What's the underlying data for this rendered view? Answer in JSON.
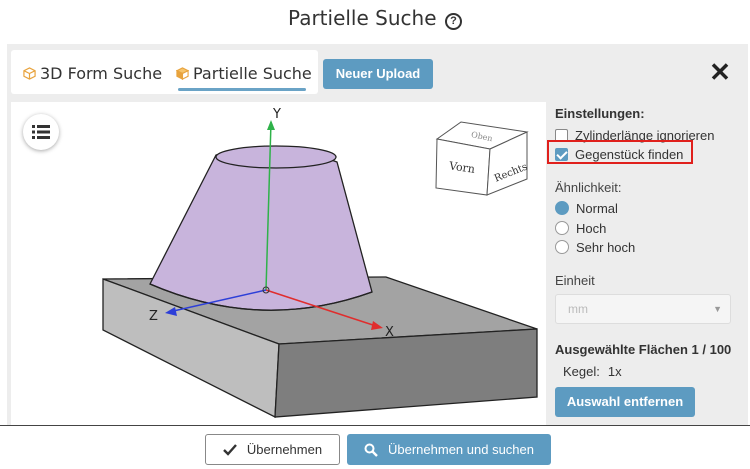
{
  "header": {
    "title": "Partielle Suche",
    "help_icon": "?"
  },
  "tabs": [
    {
      "label": "3D Form Suche",
      "icon": "cube-icon",
      "active": false
    },
    {
      "label": "Partielle Suche",
      "icon": "cube-icon",
      "active": true
    }
  ],
  "toolbar": {
    "upload_label": "Neuer Upload",
    "close_icon": "close-icon"
  },
  "viewport": {
    "menu_icon": "list-icon",
    "view_cube": {
      "front": "Vorn",
      "right": "Rechts",
      "top": "Oben"
    },
    "axes": {
      "x": "X",
      "y": "Y",
      "z": "Z"
    }
  },
  "settings": {
    "heading": "Einstellungen:",
    "options": [
      {
        "label": "Zylinderlänge ignorieren",
        "checked": false
      },
      {
        "label": "Gegenstück finden",
        "checked": true
      }
    ],
    "similarity_label": "Ähnlichkeit:",
    "similarity_options": [
      {
        "label": "Normal",
        "selected": true
      },
      {
        "label": "Hoch",
        "selected": false
      },
      {
        "label": "Sehr hoch",
        "selected": false
      }
    ],
    "unit_label": "Einheit",
    "unit_value": "mm",
    "faces_heading": "Ausgewählte Flächen 1 / 100",
    "faces_item": {
      "name": "Kegel:",
      "count": "1x"
    },
    "remove_label": "Auswahl entfernen"
  },
  "footer": {
    "apply_label": "Übernehmen",
    "apply_search_label": "Übernehmen und suchen"
  },
  "colors": {
    "accent": "#5d9bc1",
    "highlight": "#e0201c",
    "cone": "#c8b4dc",
    "base": "#9a9a9a"
  }
}
